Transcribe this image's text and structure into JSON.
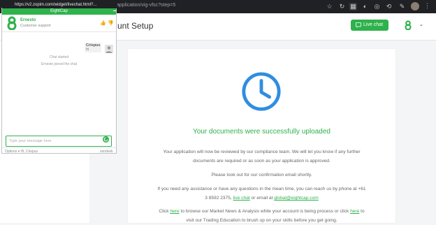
{
  "browser": {
    "chat_url": "https://v2.zopim.com/widget/livechat.html?...",
    "page_url": "application/vig-vfsc?step=5"
  },
  "header": {
    "title": "unt Setup",
    "live_chat_label": "Live chat"
  },
  "content": {
    "success_title": "Your documents were successfully uploaded",
    "p1": "Your application will now be reviewed by our compliance team. We will let you know if any further documents are required or as soon as your application is approved.",
    "p2": "Please look out for our confirmation email shortly.",
    "p3_a": "If you need any assistance or have any questions in the mean time, you can reach us by phone at +61 3 8592 2375,",
    "p3_link1": "live chat",
    "p3_b": "or email at",
    "p3_link2": "global@eightcap.com",
    "p4_a": "Click",
    "p4_link1": "here",
    "p4_b": "to browse our Market News & Analysis while your account is being process or click",
    "p4_link2": "here",
    "p4_c": "to visit our Trading Education to brush up on your skills before you get going."
  },
  "chat": {
    "window_title": "EightCap",
    "agent_name": "Ernesto",
    "agent_role": "Customer support",
    "visitor_name": "Crispus",
    "visitor_msg": "hi",
    "sys1": "Chat started",
    "sys2": "Ernesto joined the chat",
    "input_placeholder": "Type your message here",
    "footer_options": "Options",
    "footer_status": "Hi, Crispus",
    "footer_brand": "zendesk"
  },
  "colors": {
    "brand_green": "#2eb24c",
    "clock_blue": "#2f8ee0"
  }
}
